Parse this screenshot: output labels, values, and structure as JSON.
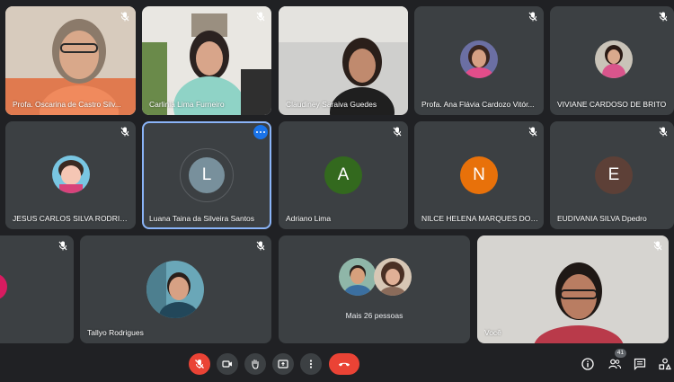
{
  "participants": [
    {
      "name": "Profa. Oscarina de Castro Silv...",
      "muted": true
    },
    {
      "name": "Carlinia Lima Furneiro",
      "muted": true
    },
    {
      "name": "Claudiney Saraiva Guedes",
      "muted": false
    },
    {
      "name": "Profa. Ana Flávia Cardozo Vitór...",
      "muted": true
    },
    {
      "name": "VIVIANE CARDOSO DE BRITO",
      "muted": true
    },
    {
      "name": "JESUS CARLOS SILVA RODRIG...",
      "muted": true
    },
    {
      "name": "Luana Taina da Silveira Santos",
      "initial": "L",
      "color": "#78909c"
    },
    {
      "name": "Adriano Lima",
      "initial": "A",
      "color": "#33691e",
      "muted": true
    },
    {
      "name": "NILCE HELENA MARQUES DOS...",
      "initial": "N",
      "color": "#e8710a",
      "muted": true
    },
    {
      "name": "EUDIVANIA SILVA Dpedro",
      "initial": "E",
      "color": "#5d4037",
      "muted": true
    },
    {
      "name": "",
      "muted": true
    },
    {
      "name": "Tallyo Rodrigues",
      "muted": true
    },
    {
      "name": "Você",
      "muted": true
    }
  ],
  "overflow": {
    "label": "Mais 26 pessoas"
  },
  "toolbar": {
    "people_count": "41"
  },
  "colors": {
    "background": "#202124",
    "tile": "#3c4043",
    "active_border": "#8ab4f8",
    "hangup": "#ea4335",
    "mic_off": "#ea4335"
  },
  "icons": [
    "mic-off-icon",
    "camera-icon",
    "raise-hand-icon",
    "present-icon",
    "more-options-icon",
    "hang-up-icon",
    "info-icon",
    "people-icon",
    "chat-icon",
    "activities-icon"
  ]
}
